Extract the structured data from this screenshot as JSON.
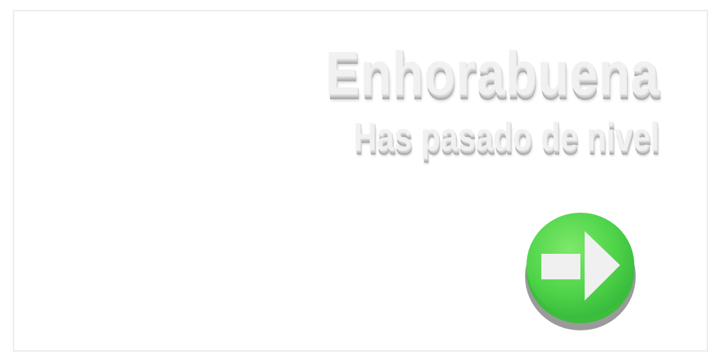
{
  "screen": {
    "title": "Enhorabuena",
    "subtitle": "Has pasado de nivel"
  },
  "next_button": {
    "icon": "arrow-right-icon",
    "color": "#4cd64a",
    "shadow_color": "#9a9a9a",
    "arrow_color": "#f0f0f0"
  }
}
